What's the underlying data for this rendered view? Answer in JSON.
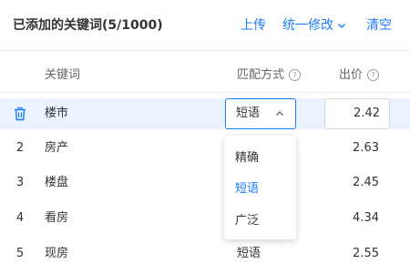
{
  "header": {
    "title": "已添加的关键词(5/1000)",
    "upload": "上传",
    "batch_edit": "统一修改",
    "clear": "清空"
  },
  "columns": {
    "keyword": "关键词",
    "match_type": "匹配方式",
    "bid": "出价",
    "help_glyph": "?"
  },
  "rows": [
    {
      "index": "",
      "keyword": "楼市",
      "match": "短语",
      "bid": "2.42"
    },
    {
      "index": "2",
      "keyword": "房产",
      "match": "",
      "bid": "2.63"
    },
    {
      "index": "3",
      "keyword": "楼盘",
      "match": "",
      "bid": "2.45"
    },
    {
      "index": "4",
      "keyword": "看房",
      "match": "",
      "bid": "4.34"
    },
    {
      "index": "5",
      "keyword": "现房",
      "match": "短语",
      "bid": "2.55"
    }
  ],
  "dropdown": {
    "options": [
      "精确",
      "短语",
      "广泛"
    ],
    "selected": "短语"
  },
  "colors": {
    "accent": "#1a7cff",
    "row_highlight": "#eaf3ff"
  },
  "icons": {
    "row1_action": "trash-icon",
    "help": "help-circle-icon",
    "dropdown": "chevron-down-icon",
    "select_open": "chevron-up-icon"
  }
}
